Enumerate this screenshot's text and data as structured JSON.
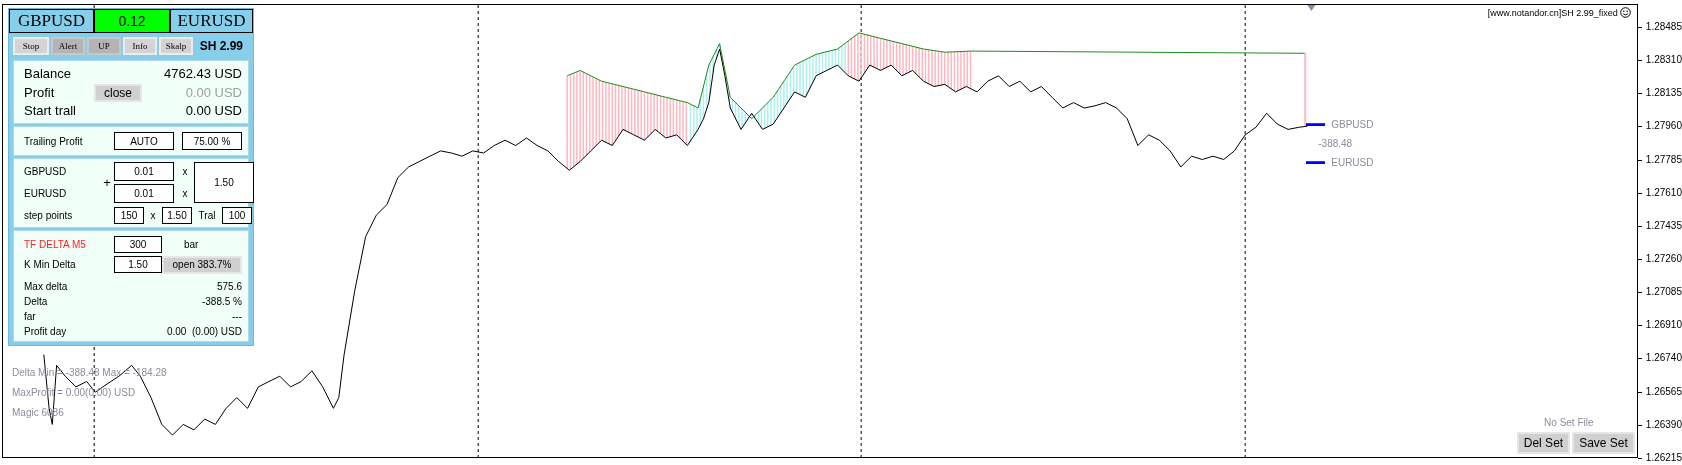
{
  "header": {
    "left_symbol": "GBPUSD",
    "value": "0.12",
    "right_symbol": "EURUSD"
  },
  "tabs": [
    {
      "label": "Stop",
      "selected": false
    },
    {
      "label": "Alert",
      "selected": true
    },
    {
      "label": "UP",
      "selected": true
    },
    {
      "label": "Info",
      "selected": false
    },
    {
      "label": "Skalp",
      "selected": false
    }
  ],
  "version": "SH 2.99",
  "account": {
    "rows": [
      {
        "label": "Balance",
        "value": "4762.43 USD",
        "dimmed": false
      },
      {
        "label": "Profit",
        "value": "0.00 USD",
        "dimmed": true
      },
      {
        "label": "Start trall",
        "value": "0.00 USD",
        "dimmed": false
      }
    ],
    "close_button": "close"
  },
  "trailing": {
    "label": "Trailing Profit",
    "mode": "AUTO",
    "percent": "75.00 %"
  },
  "lots": {
    "plus": "+",
    "rows": [
      {
        "symbol": "GBPUSD",
        "lot": "0.01",
        "times": "x"
      },
      {
        "symbol": "EURUSD",
        "lot": "0.01",
        "times": "x"
      }
    ],
    "multiplier": "1.50",
    "step": {
      "label": "step points",
      "points": "150",
      "times": "x",
      "factor": "1.50",
      "tral_label": "Tral",
      "tral": "100"
    }
  },
  "delta": {
    "tf_label": "TF DELTA M5",
    "bars": "300",
    "bars_unit": "bar",
    "k_label": "K Min Delta",
    "k_value": "1.50",
    "open_button": "open 383.7%",
    "stats": [
      {
        "label": "Max delta",
        "value": "575.6"
      },
      {
        "label": "Delta",
        "value": "-388.5 %"
      },
      {
        "label": "far",
        "value": "---"
      },
      {
        "label": "Profit day",
        "value": "0.00  (0.00) USD"
      }
    ]
  },
  "chart_info": [
    "Delta Min = -388.48  Max = -184.28",
    "MaxProfit = 0.00(0.00) USD",
    "Magic 6086"
  ],
  "chart_title": "[www.notandor.cn]SH 2.99_fixed",
  "legend": {
    "top": "GBPUSD",
    "spread": "-388.48",
    "bottom": "EURUSD"
  },
  "set_file": {
    "status": "No Set File",
    "buttons": [
      "Del Set",
      "Save Set"
    ]
  },
  "price_axis": [
    "1.28485",
    "1.28310",
    "1.28135",
    "1.27960",
    "1.27785",
    "1.27610",
    "1.27435",
    "1.27260",
    "1.27085",
    "1.26910",
    "1.26740",
    "1.26565",
    "1.26390",
    "1.26215"
  ]
}
